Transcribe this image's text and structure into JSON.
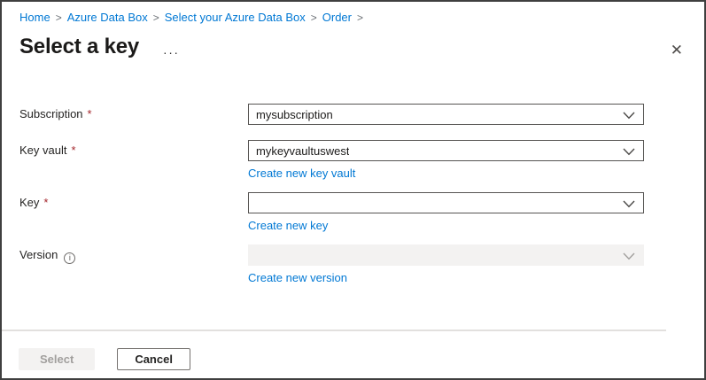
{
  "breadcrumb": {
    "separator": ">",
    "items": [
      "Home",
      "Azure Data Box",
      "Select your Azure Data Box",
      "Order"
    ]
  },
  "header": {
    "title": "Select a key"
  },
  "icons": {
    "close": "✕",
    "more": "···",
    "info": "i"
  },
  "form": {
    "required_mark": "*",
    "fields": [
      {
        "label": "Subscription",
        "required": true,
        "value": "mysubscription",
        "link": "",
        "disabled": false
      },
      {
        "label": "Key vault",
        "required": true,
        "value": "mykeyvaultuswest",
        "link": "Create new key vault",
        "disabled": false
      },
      {
        "label": "Key",
        "required": true,
        "value": "",
        "link": "Create new key",
        "disabled": false
      },
      {
        "label": "Version",
        "required": false,
        "value": "",
        "link": "Create new version",
        "disabled": true,
        "has_info_icon": true
      }
    ]
  },
  "footer": {
    "select_label": "Select",
    "select_enabled": false,
    "cancel_label": "Cancel"
  },
  "colors": {
    "link_blue": "#0078d4",
    "required_red": "#a4262c",
    "disabled_bg": "#f3f2f1",
    "text_primary": "#1b1a19",
    "border_dark": "#565452"
  }
}
